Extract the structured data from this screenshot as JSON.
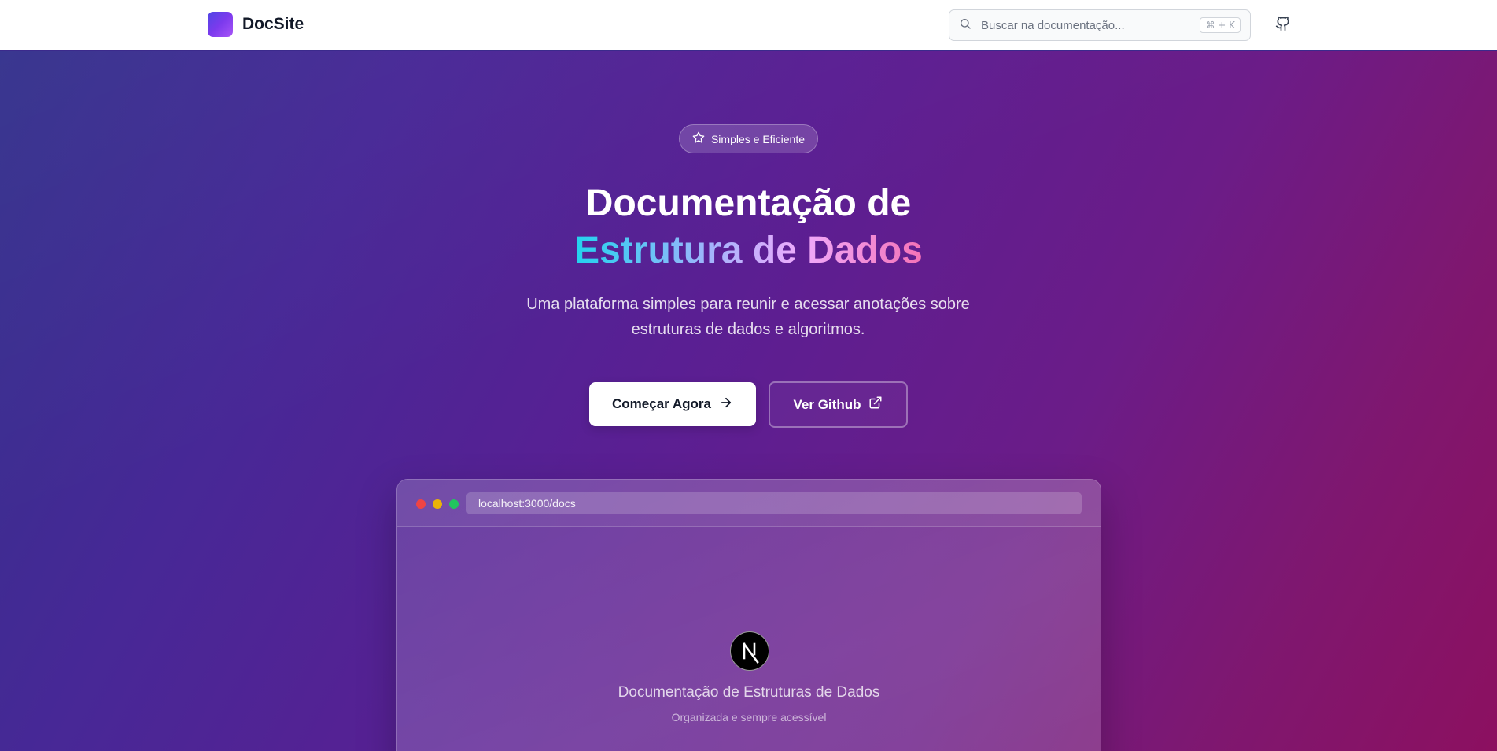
{
  "header": {
    "brand_name": "DocSite",
    "search_placeholder": "Buscar na documentação...",
    "search_shortcut": "⌘ + K",
    "github_icon": "github-icon"
  },
  "hero": {
    "badge_label": "Simples e Eficiente",
    "badge_icon": "star-icon",
    "title_line1": "Documentação de",
    "title_line2": "Estrutura de Dados",
    "subtitle": "Uma plataforma simples para reunir e acessar anotações sobre estruturas de dados e algoritmos.",
    "primary_button": "Começar Agora",
    "secondary_button": "Ver Github"
  },
  "mockup": {
    "url": "localhost:3000/docs",
    "logo_icon": "nextjs-icon",
    "title": "Documentação de Estruturas de Dados",
    "subtitle": "Organizada e sempre acessível"
  },
  "colors": {
    "hero_gradient_start": "#33318c",
    "hero_gradient_end": "#8c1060",
    "title_gradient": [
      "#22d3ee",
      "#a5b4fc",
      "#f0abfc",
      "#f472b6"
    ],
    "brand_logo": "#7c3aed"
  }
}
